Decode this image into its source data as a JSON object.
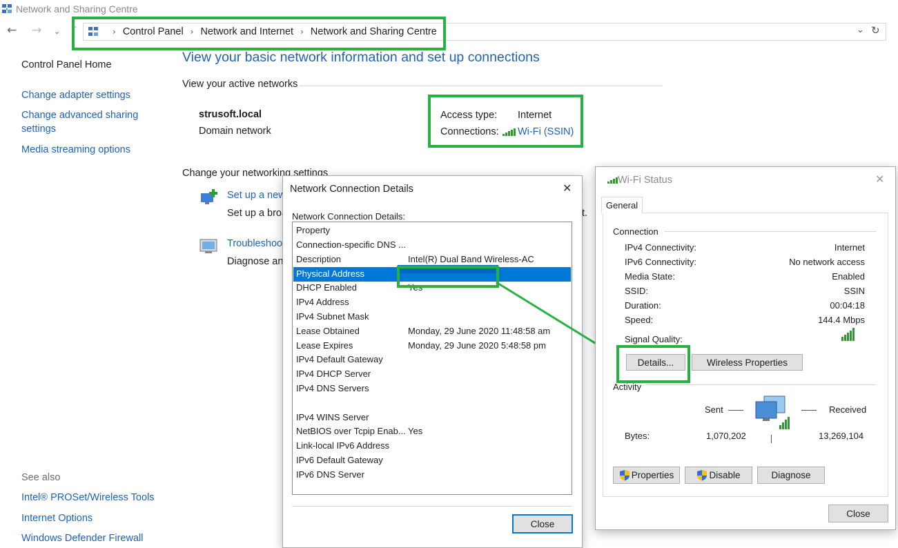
{
  "window": {
    "title": "Network and Sharing Centre"
  },
  "breadcrumb": [
    "Control Panel",
    "Network and Internet",
    "Network and Sharing Centre"
  ],
  "sidebar": {
    "home": "Control Panel Home",
    "links": [
      "Change adapter settings",
      "Change advanced sharing",
      "settings",
      "Media streaming options"
    ],
    "see_also_title": "See also",
    "see_also": [
      "Intel® PROSet/Wireless Tools",
      "Internet Options",
      "Windows Defender Firewall"
    ]
  },
  "main": {
    "title": "View your basic network information and set up connections",
    "active_networks_header": "View your active networks",
    "network_name": "strusoft.local",
    "network_type": "Domain network",
    "access_type_label": "Access type:",
    "access_type_value": "Internet",
    "connections_label": "Connections:",
    "connection_link": "Wi-Fi (SSIN)",
    "change_settings_header": "Change your networking settings",
    "setup_link": "Set up a new",
    "setup_desc": "Set up a broa",
    "setup_desc_tail": "t.",
    "troubleshoot_link": "Troubleshoot",
    "troubleshoot_desc": "Diagnose and"
  },
  "details_dialog": {
    "title": "Network Connection Details",
    "close_glyph": "✕",
    "list_caption": "Network Connection Details:",
    "header_property": "Property",
    "rows": [
      {
        "property": "Connection-specific DNS ...",
        "value": ""
      },
      {
        "property": "Description",
        "value": "Intel(R) Dual Band Wireless-AC"
      },
      {
        "property": "Physical Address",
        "value": "",
        "selected": true
      },
      {
        "property": "DHCP Enabled",
        "value": "Yes"
      },
      {
        "property": "IPv4 Address",
        "value": ""
      },
      {
        "property": "IPv4 Subnet Mask",
        "value": ""
      },
      {
        "property": "Lease Obtained",
        "value": "Monday, 29 June 2020 11:48:58 am"
      },
      {
        "property": "Lease Expires",
        "value": "Monday, 29 June 2020 5:48:58 pm"
      },
      {
        "property": "IPv4 Default Gateway",
        "value": ""
      },
      {
        "property": "IPv4 DHCP Server",
        "value": ""
      },
      {
        "property": "IPv4 DNS Servers",
        "value": ""
      },
      {
        "property": "",
        "value": ""
      },
      {
        "property": "IPv4 WINS Server",
        "value": ""
      },
      {
        "property": "NetBIOS over Tcpip Enab...",
        "value": "Yes"
      },
      {
        "property": "Link-local IPv6 Address",
        "value": ""
      },
      {
        "property": "IPv6 Default Gateway",
        "value": ""
      },
      {
        "property": "IPv6 DNS Server",
        "value": ""
      }
    ],
    "close_button": "Close"
  },
  "wifi_dialog": {
    "title": "Wi-Fi Status",
    "close_glyph": "✕",
    "tab": "General",
    "connection_group": "Connection",
    "fields": [
      {
        "label": "IPv4 Connectivity:",
        "value": "Internet"
      },
      {
        "label": "IPv6 Connectivity:",
        "value": "No network access"
      },
      {
        "label": "Media State:",
        "value": "Enabled"
      },
      {
        "label": "SSID:",
        "value": "SSIN"
      },
      {
        "label": "Duration:",
        "value": "00:04:18"
      },
      {
        "label": "Speed:",
        "value": "144.4 Mbps"
      }
    ],
    "signal_label": "Signal Quality:",
    "signal_bars": 5,
    "details_button": "Details...",
    "wireless_props_button": "Wireless Properties",
    "activity_group": "Activity",
    "sent_label": "Sent",
    "received_label": "Received",
    "bytes_label": "Bytes:",
    "bytes_sent": "1,070,202",
    "bytes_received": "13,269,104",
    "properties_button": "Properties",
    "disable_button": "Disable",
    "diagnose_button": "Diagnose",
    "close_button": "Close"
  },
  "colors": {
    "link": "#1d62b8",
    "highlight": "#29b043",
    "selection": "#0078d7"
  }
}
